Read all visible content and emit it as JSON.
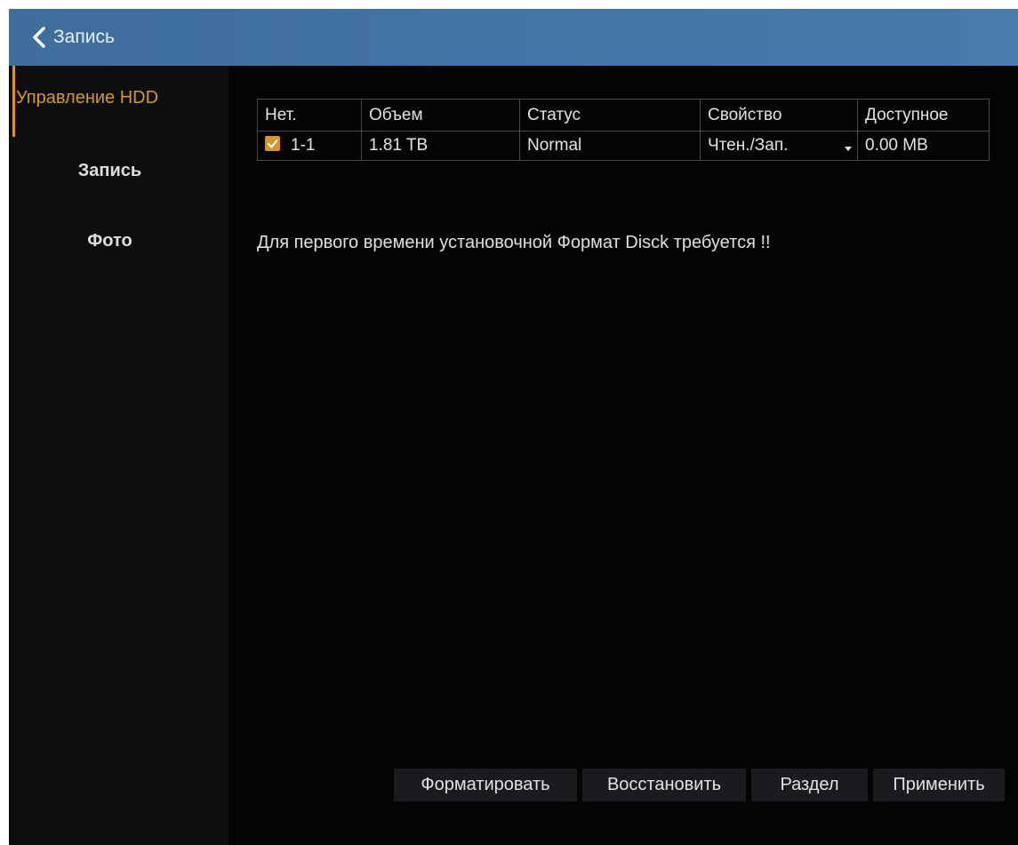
{
  "header": {
    "back_label": "Запись",
    "back_icon": "chevron-left-icon"
  },
  "sidebar": {
    "items": [
      {
        "label": "Управление HDD",
        "active": true
      },
      {
        "label": "Запись",
        "active": false
      },
      {
        "label": "Фото",
        "active": false
      }
    ]
  },
  "table": {
    "columns": [
      "Нет.",
      "Объем",
      "Статус",
      "Свойство",
      "Доступное"
    ],
    "rows": [
      {
        "checked": true,
        "no": "1-1",
        "capacity": "1.81 TB",
        "status": "Normal",
        "property": "Чтен./Зап.",
        "available": "0.00 MB"
      }
    ]
  },
  "notice": "Для первого времени установочной Формат Disck требуется !!",
  "buttons": {
    "format": "Форматировать",
    "restore": "Восстановить",
    "partition": "Раздел",
    "apply": "Применить"
  },
  "colors": {
    "accent": "#d9952d",
    "header": "#4474a3",
    "background": "#060607"
  }
}
